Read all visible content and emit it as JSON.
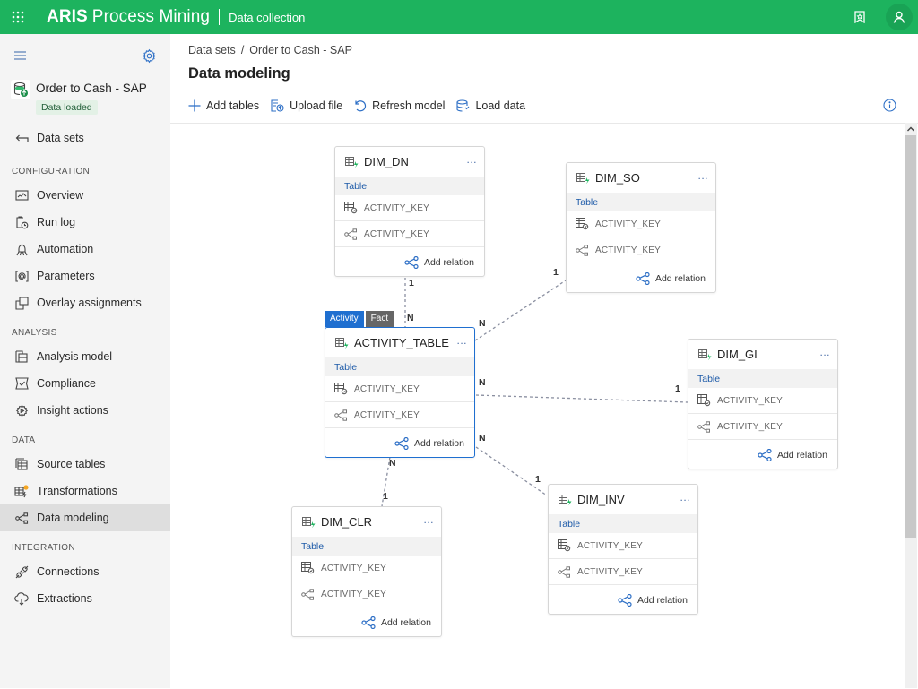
{
  "topbar": {
    "brand_bold": "ARIS",
    "brand_rest": "Process Mining",
    "module": "Data collection",
    "icons": [
      "apps-grid-icon",
      "bookmark-icon",
      "user-icon"
    ]
  },
  "sidebar": {
    "dataset": {
      "name": "Order to Cash - SAP",
      "status": "Data loaded"
    },
    "back_label": "Data sets",
    "sections": [
      {
        "title": "CONFIGURATION",
        "items": [
          {
            "label": "Overview",
            "icon": "overview-icon"
          },
          {
            "label": "Run log",
            "icon": "run-log-icon"
          },
          {
            "label": "Automation",
            "icon": "automation-icon"
          },
          {
            "label": "Parameters",
            "icon": "parameters-icon"
          },
          {
            "label": "Overlay assignments",
            "icon": "overlay-icon"
          }
        ]
      },
      {
        "title": "ANALYSIS",
        "items": [
          {
            "label": "Analysis model",
            "icon": "analysis-model-icon"
          },
          {
            "label": "Compliance",
            "icon": "compliance-icon"
          },
          {
            "label": "Insight actions",
            "icon": "insight-actions-icon"
          }
        ]
      },
      {
        "title": "DATA",
        "items": [
          {
            "label": "Source tables",
            "icon": "source-tables-icon"
          },
          {
            "label": "Transformations",
            "icon": "transformations-icon"
          },
          {
            "label": "Data modeling",
            "icon": "data-modeling-icon",
            "active": true
          }
        ]
      },
      {
        "title": "INTEGRATION",
        "items": [
          {
            "label": "Connections",
            "icon": "connections-icon"
          },
          {
            "label": "Extractions",
            "icon": "extractions-icon"
          }
        ]
      }
    ]
  },
  "main": {
    "breadcrumb": [
      "Data sets",
      "Order to Cash - SAP"
    ],
    "title": "Data modeling",
    "toolbar": [
      "Add tables",
      "Upload file",
      "Refresh model",
      "Load data"
    ]
  },
  "colors": {
    "brand": "#1db35e",
    "accent": "#1f6fd0",
    "badge_bg": "#e3f1e6"
  },
  "model": {
    "tables": [
      {
        "id": "activity",
        "name": "ACTIVITY_TABLE",
        "type": "Table",
        "tags": [
          "Activity",
          "Fact"
        ],
        "selected": true,
        "fields": [
          "ACTIVITY_KEY",
          "ACTIVITY_KEY"
        ],
        "action": "Add relation",
        "more": "..."
      },
      {
        "id": "dim_dn",
        "name": "DIM_DN",
        "type": "Table",
        "fields": [
          "ACTIVITY_KEY",
          "ACTIVITY_KEY"
        ],
        "action": "Add relation",
        "more": "..."
      },
      {
        "id": "dim_so",
        "name": "DIM_SO",
        "type": "Table",
        "fields": [
          "ACTIVITY_KEY",
          "ACTIVITY_KEY"
        ],
        "action": "Add relation",
        "more": "..."
      },
      {
        "id": "dim_gi",
        "name": "DIM_GI",
        "type": "Table",
        "fields": [
          "ACTIVITY_KEY",
          "ACTIVITY_KEY"
        ],
        "action": "Add relation",
        "more": "..."
      },
      {
        "id": "dim_clr",
        "name": "DIM_CLR",
        "type": "Table",
        "fields": [
          "ACTIVITY_KEY",
          "ACTIVITY_KEY"
        ],
        "action": "Add relation",
        "more": "..."
      },
      {
        "id": "dim_inv",
        "name": "DIM_INV",
        "type": "Table",
        "fields": [
          "ACTIVITY_KEY",
          "ACTIVITY_KEY"
        ],
        "action": "Add relation",
        "more": "..."
      }
    ],
    "relations": [
      {
        "from": "activity",
        "to": "dim_dn",
        "from_card": "N",
        "to_card": "1"
      },
      {
        "from": "activity",
        "to": "dim_so",
        "from_card": "N",
        "to_card": "1"
      },
      {
        "from": "activity",
        "to": "dim_gi",
        "from_card": "N",
        "to_card": "1"
      },
      {
        "from": "activity",
        "to": "dim_inv",
        "from_card": "N",
        "to_card": "1"
      },
      {
        "from": "activity",
        "to": "dim_clr",
        "from_card": "N",
        "to_card": "1"
      }
    ]
  }
}
